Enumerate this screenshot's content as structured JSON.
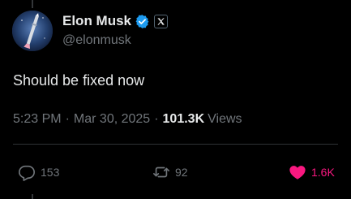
{
  "user": {
    "display_name": "Elon Musk",
    "handle": "@elonmusk",
    "verified": true,
    "affiliation_icon": "x-logo-icon"
  },
  "tweet": {
    "text": "Should be fixed now",
    "time": "5:23 PM",
    "separator": "·",
    "date": "Mar 30, 2025",
    "views_count": "101.3K",
    "views_label": "Views"
  },
  "actions": {
    "replies": "153",
    "reposts": "92",
    "likes": "1.6K",
    "liked": true
  },
  "colors": {
    "background": "#000000",
    "primary_text": "#e7e9ea",
    "secondary_text": "#71767b",
    "verified_blue": "#1d9bf0",
    "like_pink": "#f91880",
    "divider": "#2f3336"
  }
}
